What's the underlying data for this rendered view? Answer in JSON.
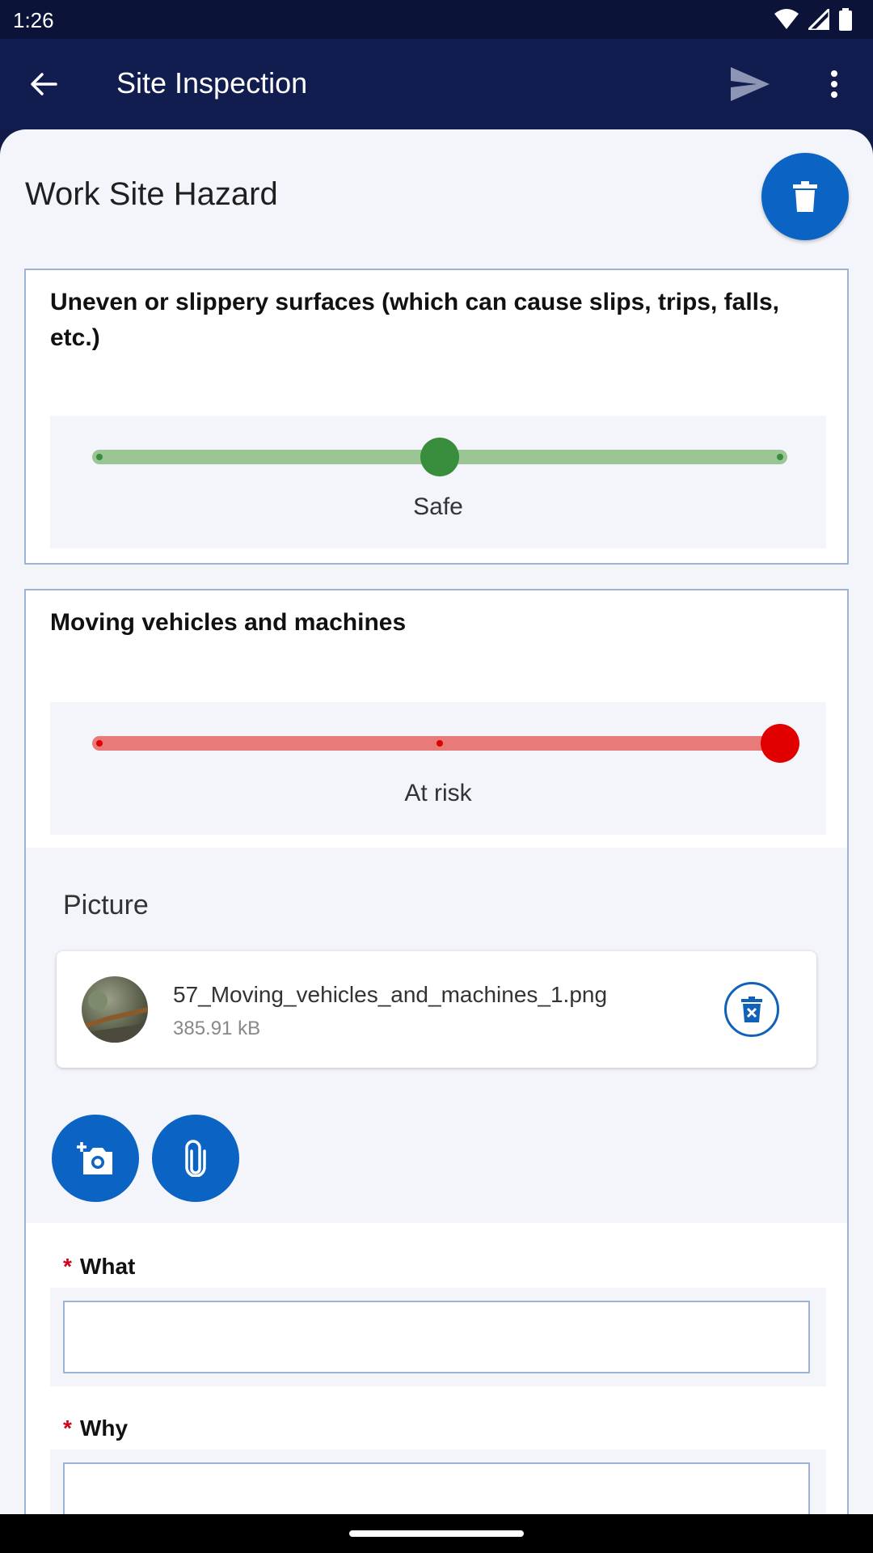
{
  "status_bar": {
    "time": "1:26",
    "icons": [
      "wifi-icon",
      "cell-signal-icon",
      "battery-icon"
    ]
  },
  "app_bar": {
    "title": "Site Inspection",
    "icons": [
      "back-arrow-icon",
      "send-icon",
      "more-vert-icon"
    ]
  },
  "section": {
    "title": "Work Site Hazard",
    "delete_icon": "trash-icon"
  },
  "questions": [
    {
      "text": "Uneven or slippery surfaces (which can cause slips, trips, falls, etc.)",
      "rating_label": "Safe",
      "rating_levels": 3,
      "rating_value": 2,
      "accent": "#388e3c",
      "track": "#9cc596"
    },
    {
      "text": "Moving vehicles and machines",
      "rating_label": "At risk",
      "rating_levels": 3,
      "rating_value": 3,
      "accent": "#e00000",
      "track": "#e97a7a",
      "picture": {
        "label": "Picture",
        "file_name": "57_Moving_vehicles_and_machines_1.png",
        "file_size": "385.91 kB",
        "actions": [
          "add-photo-icon",
          "attach-icon"
        ]
      },
      "fields": [
        {
          "label": "What",
          "required_marker": "*",
          "value": ""
        },
        {
          "label": "Why",
          "required_marker": "*",
          "value": ""
        }
      ]
    }
  ],
  "colors": {
    "primary": "#0b63c4",
    "app_bar": "#111d4f",
    "status_bar": "#0b1438",
    "border": "#9fb3d4",
    "background": "#f3f5fa"
  }
}
